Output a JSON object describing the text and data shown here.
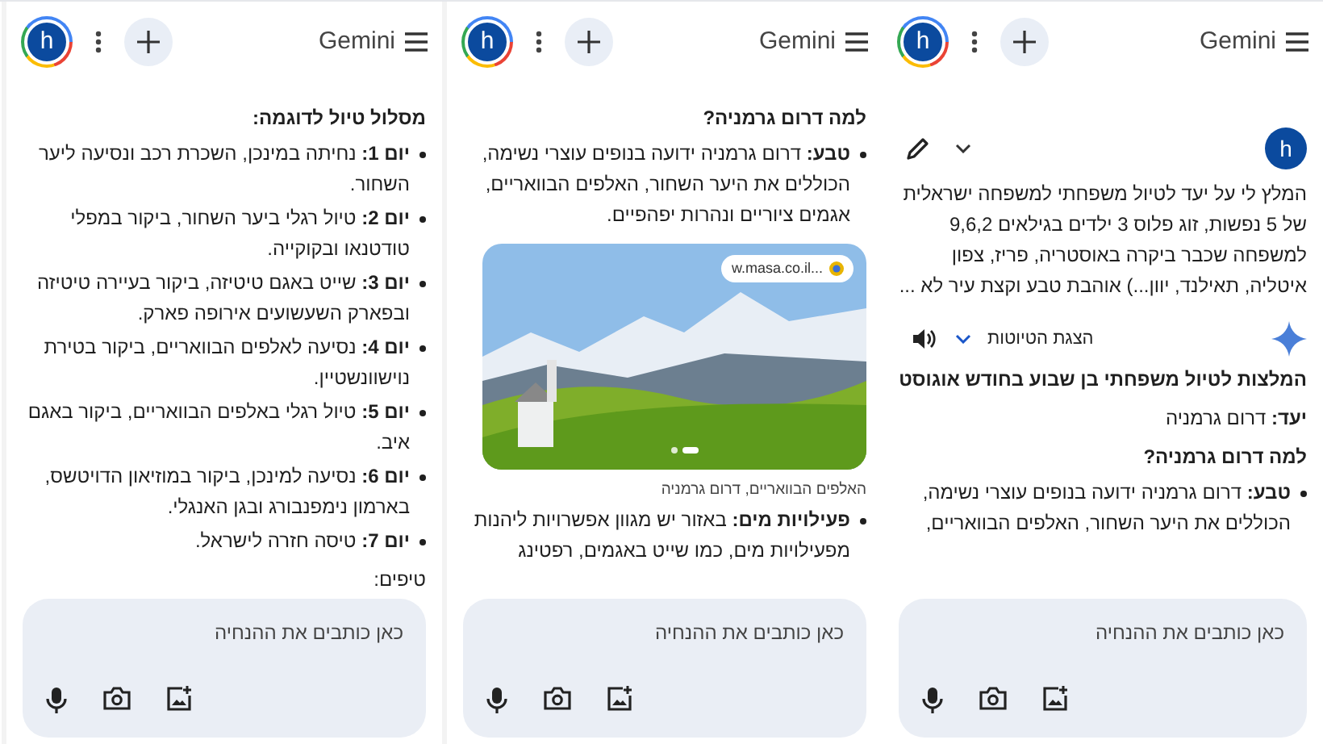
{
  "panels": [
    {
      "header": {
        "title": "Gemini",
        "avatar": "h"
      },
      "blocks": [
        {
          "kind": "user_prompt",
          "avatar": "h",
          "text": "המלץ לי על יעד לטיול משפחתי למשפחה ישראלית של 5 נפשות, זוג פלוס 3 ילדים בגילאים 9,6,2 למשפחה שכבר ביקרה באוסטריה, פריז, צפון איטליה, תאילנד, יוון...) אוהבת טבע וקצת עיר לא ..."
        },
        {
          "kind": "response_header",
          "label": "הצגת הטיוטות"
        },
        {
          "kind": "heading",
          "text": "המלצות לטיול משפחתי בן שבוע בחודש אוגוסט"
        },
        {
          "kind": "paragraph",
          "text": "**יעד:** דרום גרמניה"
        },
        {
          "kind": "heading",
          "text": "למה דרום גרמניה?"
        },
        {
          "kind": "bullet",
          "text": "**טבע:** דרום גרמניה ידועה בנופים עוצרי נשימה, הכוללים את היער השחור, האלפים הבוואריים,"
        }
      ],
      "composer": {
        "placeholder": "כאן כותבים את ההנחיה"
      }
    },
    {
      "header": {
        "title": "Gemini",
        "avatar": "h"
      },
      "blocks": [
        {
          "kind": "heading",
          "text": "למה דרום גרמניה?"
        },
        {
          "kind": "bullet",
          "text": "**טבע:** דרום גרמניה ידועה בנופים עוצרי נשימה, הכוללים את היער השחור, האלפים הבוואריים, אגמים ציוריים ונהרות יפהפיים."
        },
        {
          "kind": "image",
          "source": "w.masa.co.il...",
          "caption": "האלפים הבוואריים, דרום גרמניה"
        },
        {
          "kind": "bullet",
          "text": "**פעילויות מים:** באזור יש מגוון אפשרויות ליהנות מפעילויות מים, כמו שייט באגמים, רפטינג"
        }
      ],
      "composer": {
        "placeholder": "כאן כותבים את ההנחיה"
      }
    },
    {
      "header": {
        "title": "Gemini",
        "avatar": "h"
      },
      "blocks": [
        {
          "kind": "heading",
          "text": "מסלול טיול לדוגמה:"
        },
        {
          "kind": "bullet",
          "text": "**יום 1:** נחיתה במינכן, השכרת רכב ונסיעה ליער השחור."
        },
        {
          "kind": "bullet",
          "text": "**יום 2:** טיול רגלי ביער השחור, ביקור במפלי טודטנאו ובקוקייה."
        },
        {
          "kind": "bullet",
          "text": "**יום 3:** שייט באגם טיטיזה, ביקור בעיירה טיטיזה ובפארק השעשועים אירופה פארק."
        },
        {
          "kind": "bullet",
          "text": "**יום 4:** נסיעה לאלפים הבוואריים, ביקור בטירת נוישוונשטיין."
        },
        {
          "kind": "bullet",
          "text": "**יום 5:** טיול רגלי באלפים הבוואריים, ביקור באגם איב."
        },
        {
          "kind": "bullet",
          "text": "**יום 6:** נסיעה למינכן, ביקור במוזיאון הדויטשס, בארמון נימפנבורג ובגן האנגלי."
        },
        {
          "kind": "bullet",
          "text": "**יום 7:** טיסה חזרה לישראל."
        },
        {
          "kind": "paragraph",
          "text": "טיפים:"
        }
      ],
      "composer": {
        "placeholder": "כאן כותבים את ההנחיה"
      }
    }
  ]
}
